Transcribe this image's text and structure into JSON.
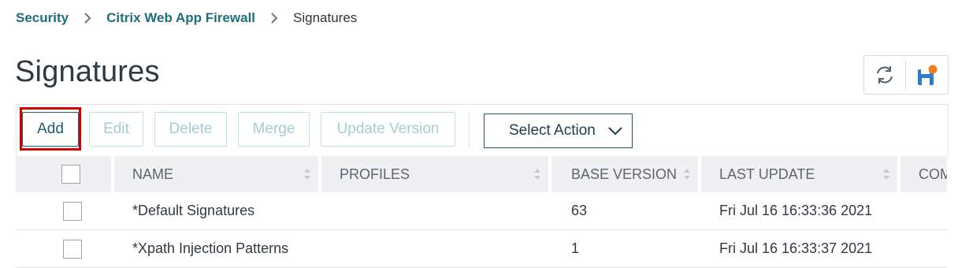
{
  "breadcrumb": {
    "items": [
      "Security",
      "Citrix Web App Firewall"
    ],
    "current": "Signatures"
  },
  "page_title": "Signatures",
  "toolbar": {
    "buttons": [
      "Add",
      "Edit",
      "Delete",
      "Merge",
      "Update Version"
    ],
    "select_action": "Select Action"
  },
  "table": {
    "columns": [
      "NAME",
      "PROFILES",
      "BASE VERSION",
      "LAST UPDATE",
      "COM"
    ],
    "rows": [
      {
        "name": "*Default Signatures",
        "profiles": "",
        "base_version": "63",
        "last_update": "Fri Jul 16 16:33:36 2021"
      },
      {
        "name": "*Xpath Injection Patterns",
        "profiles": "",
        "base_version": "1",
        "last_update": "Fri Jul 16 16:33:37 2021"
      }
    ]
  },
  "colors": {
    "accent": "#1f6e7c",
    "highlight": "#d40000",
    "save_dot": "#f47c20",
    "save_icon": "#2d7dc8"
  },
  "icons": [
    "chevron-right-icon",
    "refresh-icon",
    "save-icon",
    "chevron-down-icon",
    "sort-icon"
  ]
}
